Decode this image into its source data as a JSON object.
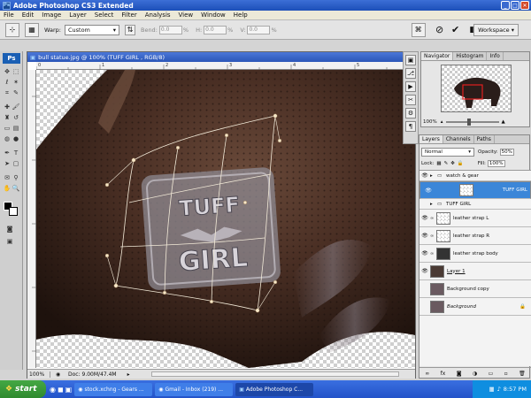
{
  "window": {
    "title": "Adobe Photoshop CS3 Extended",
    "icon_label": "Ps"
  },
  "menu": [
    "File",
    "Edit",
    "Image",
    "Layer",
    "Select",
    "Filter",
    "Analysis",
    "View",
    "Window",
    "Help"
  ],
  "options": {
    "warp_label": "Warp:",
    "warp_value": "Custom",
    "bend_label": "Bend:",
    "bend_value": "0.0",
    "h_label": "H:",
    "h_value": "0.0",
    "v_label": "V:",
    "v_value": "0.0",
    "pct": "%",
    "workspace_label": "Workspace"
  },
  "toolbox": {
    "logo": "Ps"
  },
  "document": {
    "title": "bull statue.jpg @ 100% (TUFF GIRL , RGB/8)",
    "zoom": "100%",
    "doc_info": "Doc: 9.00M/47.4M",
    "ruler_marks": [
      "0",
      "1",
      "2",
      "3",
      "4",
      "5",
      "6"
    ]
  },
  "navigator": {
    "tabs": [
      "Navigator",
      "Histogram",
      "Info"
    ],
    "zoom": "100%"
  },
  "layers_panel": {
    "tabs": [
      "Layers",
      "Channels",
      "Paths"
    ],
    "blend_mode": "Normal",
    "opacity_label": "Opacity:",
    "opacity_value": "50%",
    "lock_label": "Lock:",
    "fill_label": "Fill:",
    "fill_value": "100%",
    "layers": [
      {
        "name": "watch & gear"
      },
      {
        "name": "TUFF GIRL"
      },
      {
        "name": "TUFF GIRL"
      },
      {
        "name": "leather strap L"
      },
      {
        "name": "leather strap R"
      },
      {
        "name": "leather strap body"
      },
      {
        "name": "Layer 1"
      },
      {
        "name": "Background copy"
      },
      {
        "name": "Background"
      }
    ]
  },
  "canvas_text": {
    "top": "TUFF",
    "bottom": "GIRL"
  },
  "taskbar": {
    "start_label": "start",
    "tasks": [
      "stock.xchng - Gears ...",
      "Gmail - Inbox (219) ...",
      "Adobe Photoshop C..."
    ],
    "clock": "8:57 PM"
  }
}
